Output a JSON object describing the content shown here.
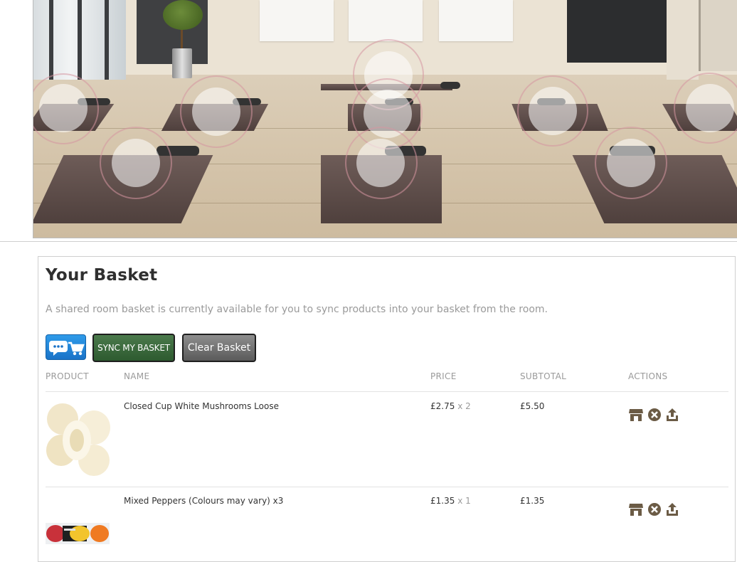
{
  "basket": {
    "title": "Your Basket",
    "description": "A shared room basket is currently available for you to sync products into your basket from the room.",
    "buttons": {
      "chat_cart_icon": "chat-cart-icon",
      "sync_label": "SYNC MY BASKET",
      "clear_label": "Clear Basket"
    },
    "columns": [
      "PRODUCT",
      "NAME",
      "PRICE",
      "SUBTOTAL",
      "ACTIONS"
    ],
    "items": [
      {
        "name": "Closed Cup White Mushrooms Loose",
        "price": "£2.75",
        "qty": "x 2",
        "subtotal": "£5.50",
        "actions": [
          "store-icon",
          "remove-icon",
          "share-icon"
        ]
      },
      {
        "name": "Mixed Peppers (Colours may vary) x3",
        "price": "£1.35",
        "qty": "x 1",
        "subtotal": "£1.35",
        "actions": [
          "store-icon",
          "remove-icon",
          "share-icon"
        ]
      }
    ]
  },
  "colors": {
    "sync_button": "#3d6b3f",
    "clear_button": "#777777",
    "chat_button": "#2186d8",
    "action_icon": "#6b5b45"
  }
}
